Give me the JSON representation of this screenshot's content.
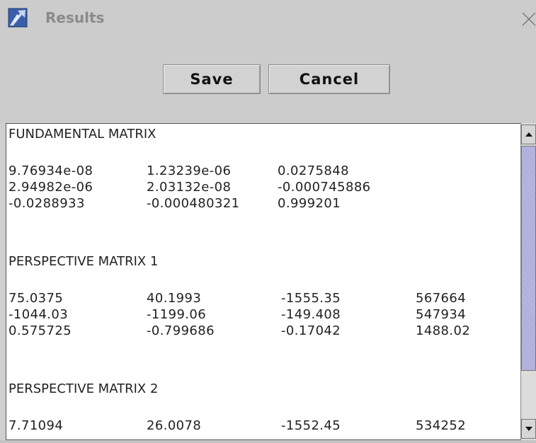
{
  "window": {
    "title": "Results",
    "icon": "pen-wrench-app-icon",
    "close_icon": "close-icon"
  },
  "toolbar": {
    "save_label": "Save",
    "cancel_label": "Cancel"
  },
  "results": {
    "fundamental_title": "FUNDAMENTAL MATRIX",
    "fundamental_rows": [
      [
        "9.76934e-08",
        "1.23239e-06",
        "0.0275848"
      ],
      [
        "2.94982e-06",
        "2.03132e-08",
        "-0.000745886"
      ],
      [
        "-0.0288933",
        "-0.000480321",
        "0.999201"
      ]
    ],
    "perspective1_title": "PERSPECTIVE MATRIX 1",
    "perspective1_rows": [
      [
        "75.0375",
        "40.1993",
        "-1555.35",
        "567664"
      ],
      [
        "-1044.03",
        "-1199.06",
        "-149.408",
        "547934"
      ],
      [
        "0.575725",
        "-0.799686",
        "-0.17042",
        "1488.02"
      ]
    ],
    "perspective2_title": "PERSPECTIVE MATRIX 2",
    "perspective2_rows": [
      [
        "7.71094",
        "26.0078",
        "-1552.45",
        "534252"
      ]
    ]
  },
  "scrollbar": {
    "up_icon": "arrow-up-icon",
    "down_icon": "arrow-down-icon"
  }
}
